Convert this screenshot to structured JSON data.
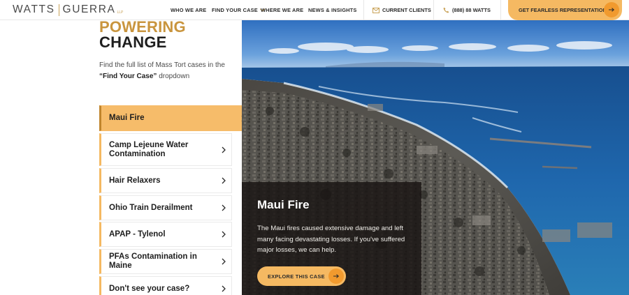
{
  "brand": {
    "name_left": "WATTS",
    "name_right": "GUERRA",
    "mark": "LLP"
  },
  "nav": [
    {
      "label": "WHO WE ARE"
    },
    {
      "label": "FIND YOUR CASE"
    },
    {
      "label": "WHERE WE ARE"
    },
    {
      "label": "NEWS & INSIGHTS"
    }
  ],
  "utility": {
    "clients": "CURRENT CLIENTS",
    "phone": "(888) 88 WATTS",
    "cta": "GET FEARLESS REPRESENTATION"
  },
  "headline": {
    "line1": "POWERING",
    "line2": "CHANGE"
  },
  "intro": {
    "text_before": "Find the full list of Mass Tort cases in the",
    "highlight": "“Find Your Case”",
    "text_after": "dropdown"
  },
  "cases": [
    {
      "label": "Maui Fire",
      "active": true
    },
    {
      "label": "Camp Lejeune Water Contamination",
      "active": false
    },
    {
      "label": "Hair Relaxers",
      "active": false
    },
    {
      "label": "Ohio Train Derailment",
      "active": false
    },
    {
      "label": "APAP - Tylenol",
      "active": false
    },
    {
      "label": "PFAs Contamination in Maine",
      "active": false
    },
    {
      "label": "Don't see your case?",
      "active": false
    }
  ],
  "feature": {
    "title": "Maui Fire",
    "body": "The Maui fires caused extensive damage and left many facing devastating losses. If you've suffered major losses, we can help.",
    "button": "EXPLORE THIS CASE"
  },
  "icons": {
    "nav_dropdown": "chevron-down-icon",
    "clients": "envelope-icon",
    "phone": "phone-icon",
    "cta": "arrow-right-icon",
    "case_item": "chevron-right-icon"
  },
  "colors": {
    "accent": "#f5b962",
    "accent_dark": "#f19a2e",
    "gold_text": "#c9953e",
    "ocean": "#1d5fa3",
    "text": "#1e1e1e"
  }
}
